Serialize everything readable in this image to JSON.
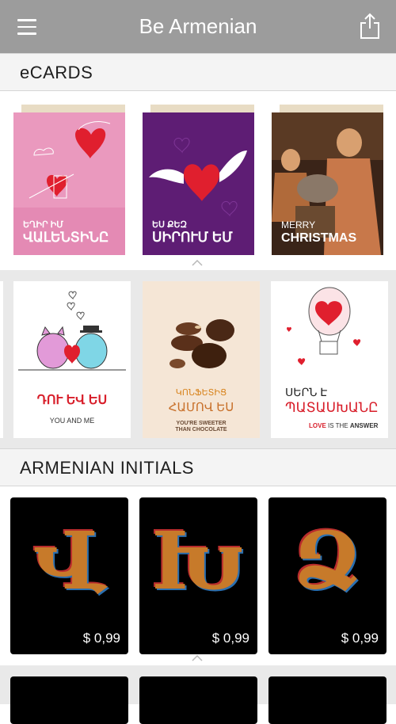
{
  "app": {
    "title": "Be Armenian",
    "menu_icon": "hamburger-menu-icon",
    "share_icon": "share-icon"
  },
  "sections": {
    "ecards": "eCARDS",
    "initials": "ARMENIAN INITIALS"
  },
  "ecards_row1": [
    {
      "line1": "ԵՂԻՐ ԻՄ",
      "line2": "ՎԱԼԵՆՏԻՆԸ"
    },
    {
      "line1": "ԵՍ ՔԵԶ",
      "line2": "ՍԻՐՈՒՄ ԵՄ"
    },
    {
      "line1": "MERRY",
      "line2": "CHRISTMAS"
    }
  ],
  "ecards_row2": [
    {
      "title": "ԴՈՒ ԵՎ ԵՍ",
      "subtitle": "YOU AND ME"
    },
    {
      "title1": "ԿՈՆՖԵՏԻՑ",
      "title2": "ՀԱՄՈՎ ԵՍ",
      "subtitle1": "YOU'RE SWEETER",
      "subtitle2": "THAN CHOCOLATE"
    },
    {
      "title1": "ՍԵՐՆ Է",
      "title2": "ՊԱՏԱՍԽԱՆԸ",
      "love": "LOVE",
      "is_the": " IS THE ",
      "answer": "ANSWER"
    }
  ],
  "initials": [
    {
      "letters": "Վ",
      "price": "$ 0,99"
    },
    {
      "letters": "Խ",
      "price": "$ 0,99"
    },
    {
      "letters": "Ձ",
      "price": "$ 0,99"
    }
  ],
  "colors": {
    "navbar": "#9c9c9c",
    "accent_red": "#d81e2a"
  }
}
